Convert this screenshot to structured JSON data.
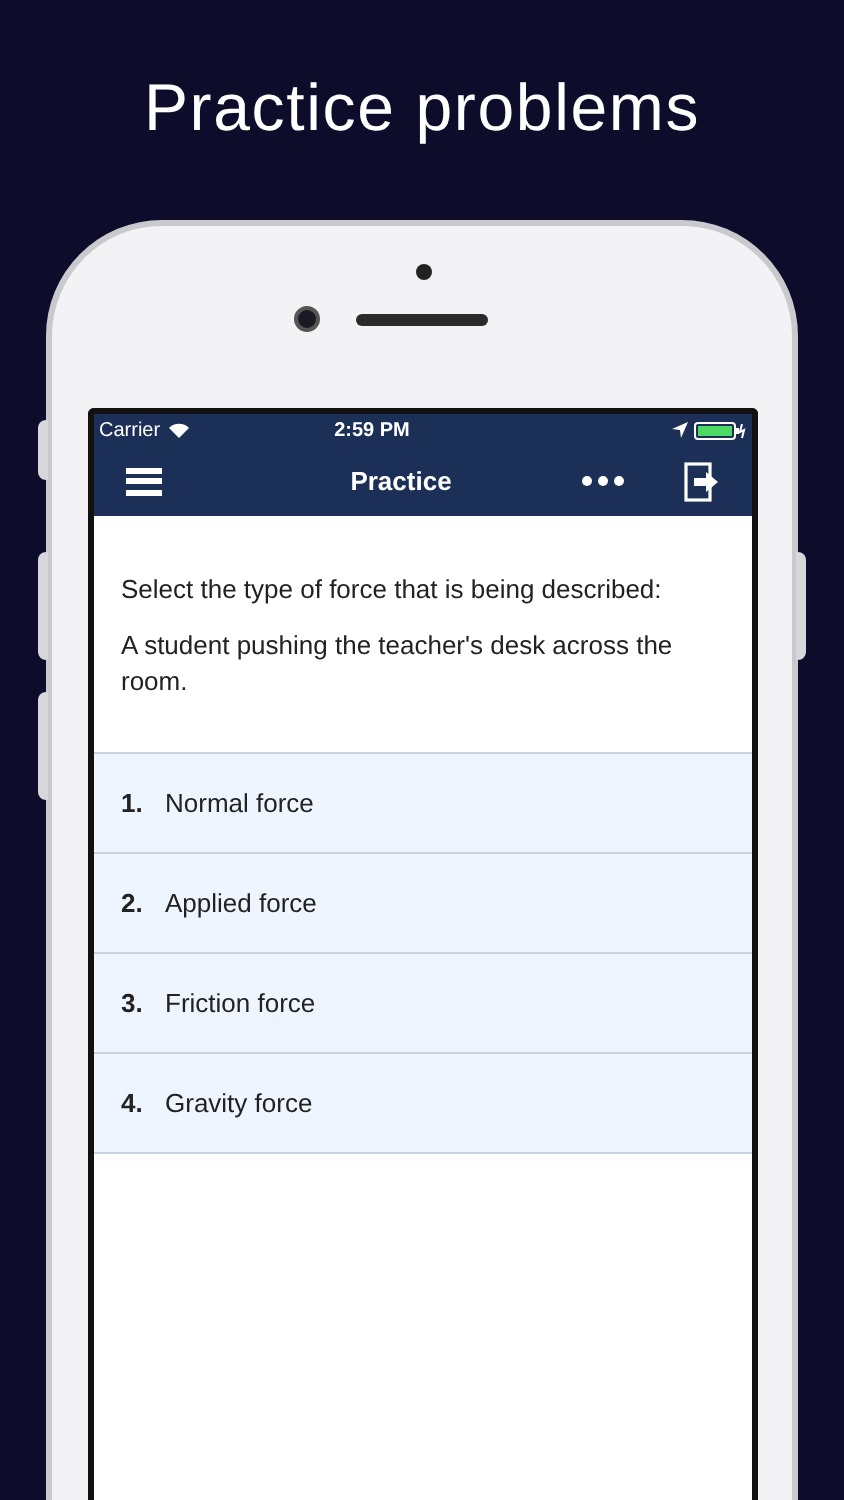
{
  "headline": "Practice problems",
  "status_bar": {
    "carrier": "Carrier",
    "time": "2:59 PM"
  },
  "nav_bar": {
    "title": "Practice"
  },
  "question": {
    "prompt": "Select the type of force that is being described:",
    "text": "A student pushing the teacher's desk across the room."
  },
  "answers": [
    {
      "number": "1.",
      "label": "Normal force",
      "selected": false
    },
    {
      "number": "2.",
      "label": "Applied force",
      "selected": false
    },
    {
      "number": "3.",
      "label": "Friction force",
      "selected": false
    },
    {
      "number": "4.",
      "label": "Gravity force",
      "selected": false
    }
  ]
}
